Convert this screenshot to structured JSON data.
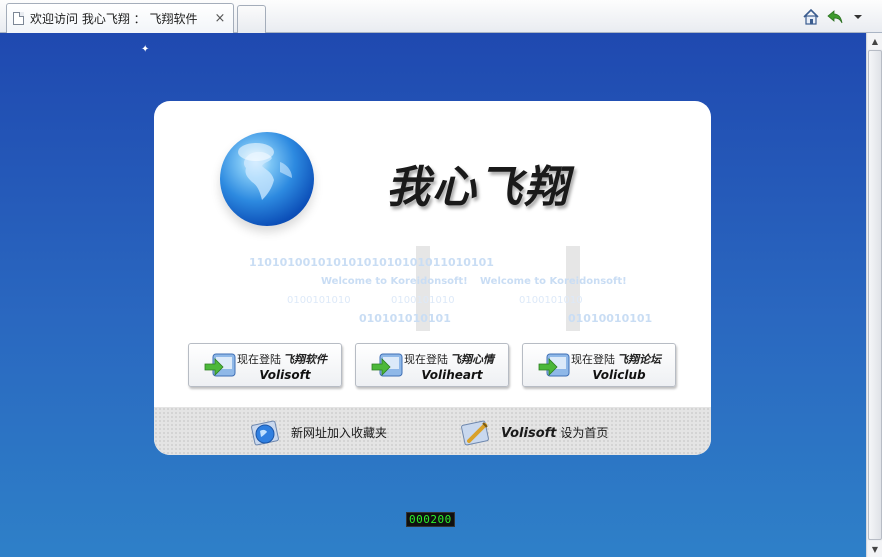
{
  "browser": {
    "tab_title": "欢迎访问 我心飞翔 ： 飞翔软件",
    "tab_close": "×",
    "scroll_up": "▲",
    "scroll_down": "▼"
  },
  "brand": {
    "logo_text": "我心飞翔"
  },
  "background_text": {
    "binary_top": "11010100101010101010101011010101",
    "welcome_1": "Welcome to Koreidonsoft!",
    "welcome_2": "Welcome to Koreidonsoft!",
    "binary_mid_1": "0100101010",
    "binary_mid_2": "0100101010",
    "binary_mid_3": "0100101010",
    "binary_low_1": "010101010101",
    "binary_low_2": "01010010101"
  },
  "buttons": [
    {
      "line1_prefix": "现在登陆",
      "line1_name": "飞翔软件",
      "line2": "Volisoft"
    },
    {
      "line1_prefix": "现在登陆",
      "line1_name": "飞翔心情",
      "line2": "Voliheart"
    },
    {
      "line1_prefix": "现在登陆",
      "line1_name": "飞翔论坛",
      "line2": "Voliclub"
    }
  ],
  "footer": {
    "bookmark_text": "新网址加入收藏夹",
    "homepage_brand": "Volisoft",
    "homepage_text": " 设为首页"
  },
  "counter": "000200",
  "colors": {
    "bg_top": "#1f49b0",
    "bg_bottom": "#2e80c8",
    "counter_digits": "#2cf02c"
  }
}
